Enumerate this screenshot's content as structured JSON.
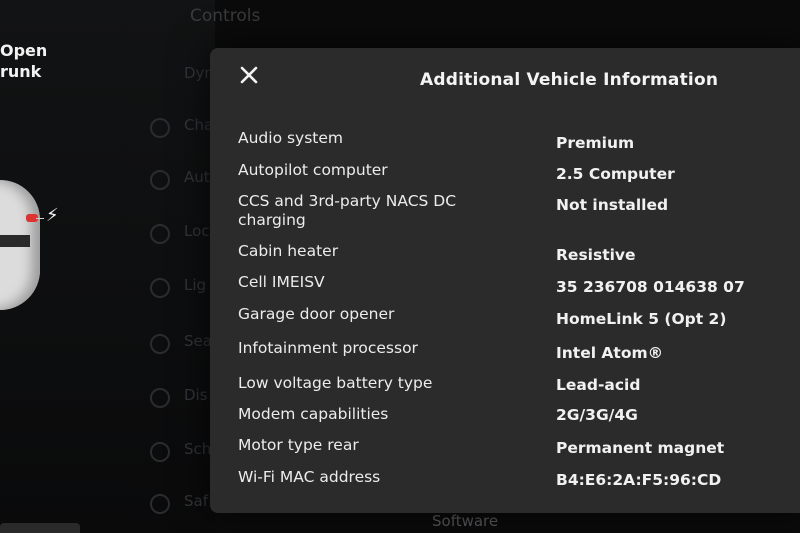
{
  "background": {
    "controls_title": "Controls",
    "open_trunk": [
      "Open",
      "runk"
    ],
    "menu_fragments": [
      "Dyn",
      "Cha",
      "Aut",
      "Loc",
      "Lig",
      "Sea",
      "Dis",
      "Sch",
      "Saf"
    ],
    "bottom_tab": "Software"
  },
  "modal": {
    "title": "Additional Vehicle Information",
    "close_icon": "close-icon",
    "rows": [
      {
        "label": "Audio system",
        "value": "Premium"
      },
      {
        "label": "Autopilot computer",
        "value": "2.5 Computer"
      },
      {
        "label": "CCS and 3rd-party NACS DC charging",
        "value": "Not installed"
      },
      {
        "label": "Cabin heater",
        "value": "Resistive"
      },
      {
        "label": "Cell IMEISV",
        "value": "35 236708 014638 07"
      },
      {
        "label": "Garage door opener",
        "value": "HomeLink 5 (Opt 2)"
      },
      {
        "label": "Infotainment processor",
        "value": "Intel Atom®"
      },
      {
        "label": "Low voltage battery type",
        "value": "Lead-acid"
      },
      {
        "label": "Modem capabilities",
        "value": "2G/3G/4G"
      },
      {
        "label": "Motor type rear",
        "value": "Permanent magnet"
      },
      {
        "label": "Wi-Fi MAC address",
        "value": "B4:E6:2A:F5:96:CD"
      }
    ]
  }
}
